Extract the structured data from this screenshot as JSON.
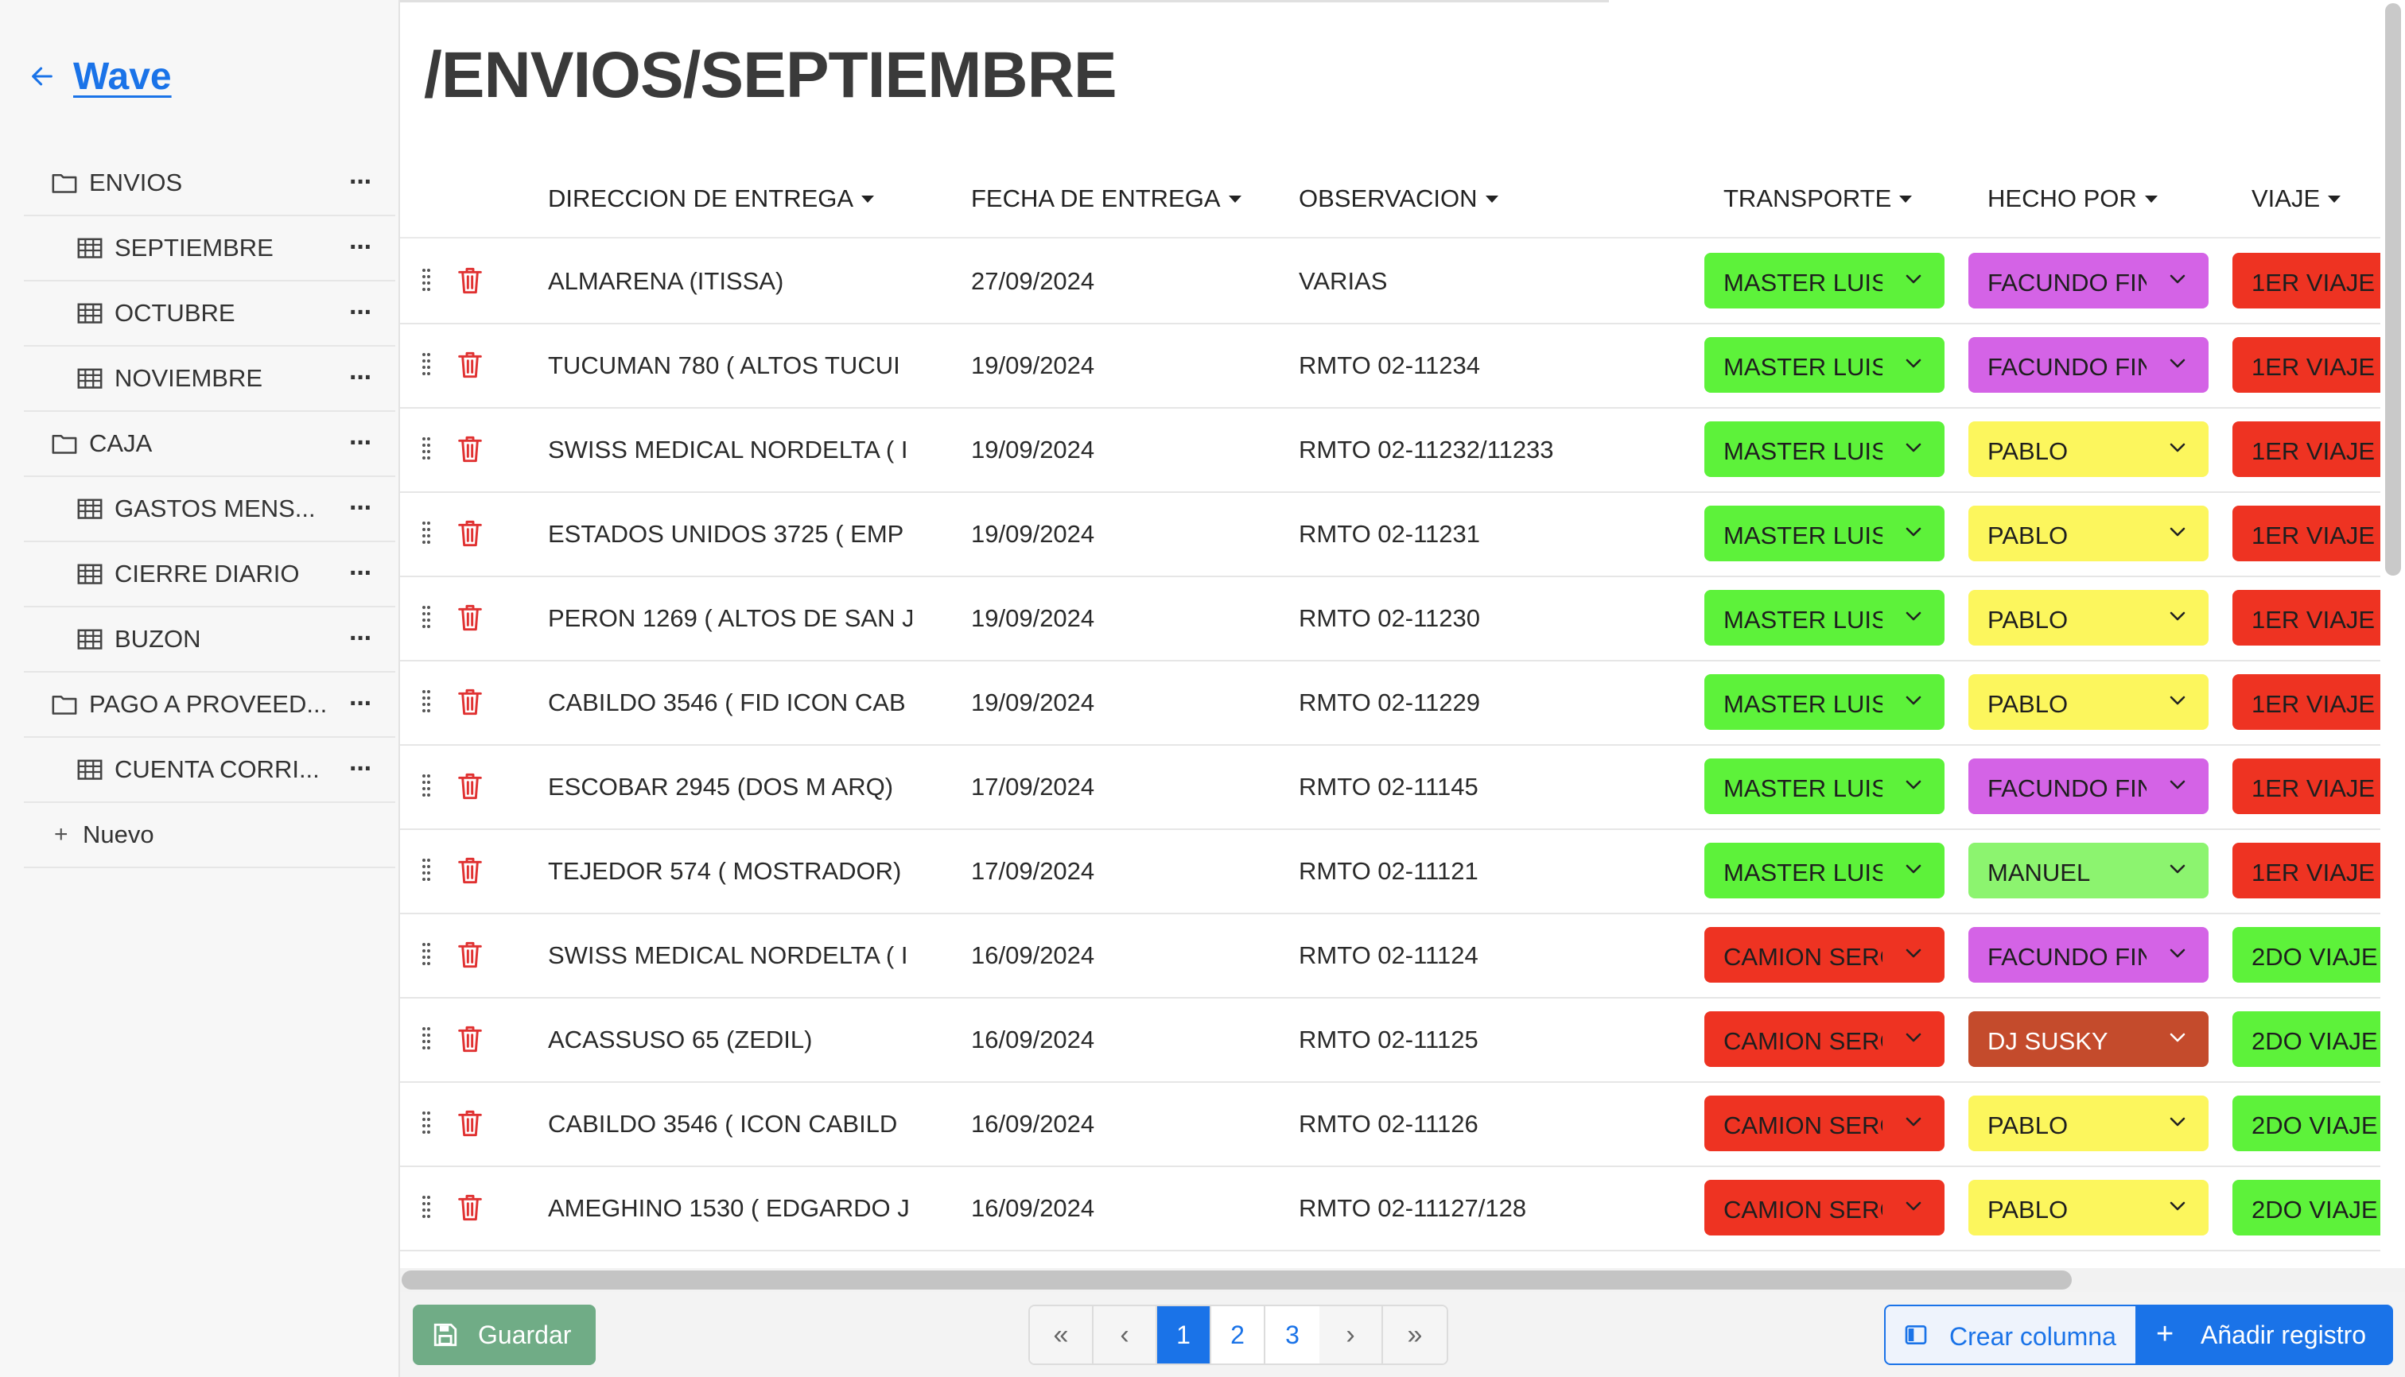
{
  "sidebar": {
    "brand": "Wave",
    "items": [
      {
        "type": "folder",
        "label": "ENVIOS"
      },
      {
        "type": "table",
        "label": "SEPTIEMBRE"
      },
      {
        "type": "table",
        "label": "OCTUBRE"
      },
      {
        "type": "table",
        "label": "NOVIEMBRE"
      },
      {
        "type": "folder",
        "label": "CAJA"
      },
      {
        "type": "table",
        "label": "GASTOS MENS..."
      },
      {
        "type": "table",
        "label": "CIERRE DIARIO"
      },
      {
        "type": "table",
        "label": "BUZON"
      },
      {
        "type": "folder",
        "label": "PAGO A PROVEED..."
      },
      {
        "type": "table",
        "label": "CUENTA CORRI..."
      }
    ],
    "new_label": "Nuevo"
  },
  "page": {
    "title": "/ENVIOS/SEPTIEMBRE"
  },
  "table": {
    "columns": {
      "direccion": "DIRECCION DE ENTREGA",
      "fecha": "FECHA DE ENTREGA",
      "observacion": "OBSERVACION",
      "transporte": "TRANSPORTE",
      "hecho_por": "HECHO POR",
      "viaje": "VIAJE"
    },
    "rows": [
      {
        "direccion": "ALMARENA (ITISSA)",
        "fecha": "27/09/2024",
        "observacion": "VARIAS",
        "transporte": "MASTER LUIS",
        "hecho_por": "FACUNDO FIN",
        "viaje": "1ER VIAJE"
      },
      {
        "direccion": "TUCUMAN 780 ( ALTOS TUCUI",
        "fecha": "19/09/2024",
        "observacion": "RMTO 02-11234",
        "transporte": "MASTER LUIS",
        "hecho_por": "FACUNDO FIN",
        "viaje": "1ER VIAJE"
      },
      {
        "direccion": "SWISS MEDICAL NORDELTA ( I",
        "fecha": "19/09/2024",
        "observacion": "RMTO 02-11232/11233",
        "transporte": "MASTER LUIS",
        "hecho_por": "PABLO",
        "viaje": "1ER VIAJE"
      },
      {
        "direccion": "ESTADOS UNIDOS 3725 ( EMP",
        "fecha": "19/09/2024",
        "observacion": "RMTO 02-11231",
        "transporte": "MASTER LUIS",
        "hecho_por": "PABLO",
        "viaje": "1ER VIAJE"
      },
      {
        "direccion": "PERON 1269 ( ALTOS DE SAN J",
        "fecha": "19/09/2024",
        "observacion": "RMTO 02-11230",
        "transporte": "MASTER LUIS",
        "hecho_por": "PABLO",
        "viaje": "1ER VIAJE"
      },
      {
        "direccion": "CABILDO 3546 ( FID ICON CAB",
        "fecha": "19/09/2024",
        "observacion": "RMTO 02-11229",
        "transporte": "MASTER LUIS",
        "hecho_por": "PABLO",
        "viaje": "1ER VIAJE"
      },
      {
        "direccion": "ESCOBAR 2945 (DOS M ARQ)",
        "fecha": "17/09/2024",
        "observacion": "RMTO 02-11145",
        "transporte": "MASTER LUIS",
        "hecho_por": "FACUNDO FIN",
        "viaje": "1ER VIAJE"
      },
      {
        "direccion": "TEJEDOR 574 ( MOSTRADOR)",
        "fecha": "17/09/2024",
        "observacion": "RMTO 02-11121",
        "transporte": "MASTER LUIS",
        "hecho_por": "MANUEL",
        "viaje": "1ER VIAJE"
      },
      {
        "direccion": "SWISS MEDICAL NORDELTA ( I",
        "fecha": "16/09/2024",
        "observacion": "RMTO 02-11124",
        "transporte": "CAMION SERG",
        "hecho_por": "FACUNDO FIN",
        "viaje": "2DO VIAJE"
      },
      {
        "direccion": "ACASSUSO 65 (ZEDIL)",
        "fecha": "16/09/2024",
        "observacion": "RMTO 02-11125",
        "transporte": "CAMION SERG",
        "hecho_por": "DJ SUSKY",
        "viaje": "2DO VIAJE"
      },
      {
        "direccion": "CABILDO 3546 ( ICON CABILD",
        "fecha": "16/09/2024",
        "observacion": "RMTO 02-11126",
        "transporte": "CAMION SERG",
        "hecho_por": "PABLO",
        "viaje": "2DO VIAJE"
      },
      {
        "direccion": "AMEGHINO 1530 ( EDGARDO J",
        "fecha": "16/09/2024",
        "observacion": "RMTO 02-11127/128",
        "transporte": "CAMION SERG",
        "hecho_por": "PABLO",
        "viaje": "2DO VIAJE"
      }
    ]
  },
  "colors": {
    "MASTER LUIS": "#5df23a",
    "CAMION SERG": "#ee3322",
    "FACUNDO FIN": "#d463e6",
    "PABLO": "#fcf65d",
    "MANUEL": "#8cf46f",
    "DJ SUSKY": "#c44b2c",
    "1ER VIAJE": "#ee3322",
    "2DO VIAJE": "#5df23a",
    "accent": "#1a73e8",
    "save_button": "#70ac86",
    "delete_icon": "#e03131"
  },
  "footer": {
    "save_label": "Guardar",
    "pages": [
      "1",
      "2",
      "3"
    ],
    "current_page": "1",
    "create_column_label": "Crear columna",
    "add_record_label": "Añadir registro"
  }
}
